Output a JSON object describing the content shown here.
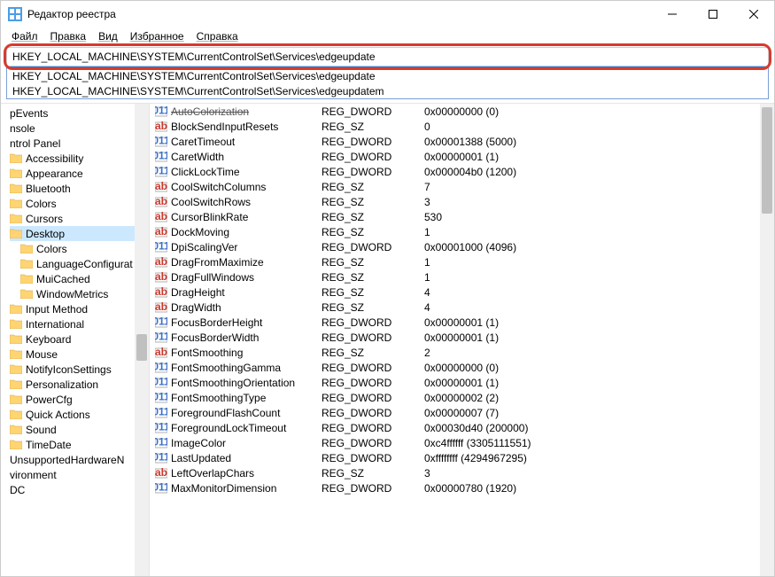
{
  "window": {
    "title": "Редактор реестра"
  },
  "menu": {
    "file": "Файл",
    "edit": "Правка",
    "view": "Вид",
    "favorites": "Избранное",
    "help": "Справка"
  },
  "address": {
    "value": "HKEY_LOCAL_MACHINE\\SYSTEM\\CurrentControlSet\\Services\\edgeupdate"
  },
  "suggestions": [
    "HKEY_LOCAL_MACHINE\\SYSTEM\\CurrentControlSet\\Services\\edgeupdate",
    "HKEY_LOCAL_MACHINE\\SYSTEM\\CurrentControlSet\\Services\\edgeupdatem"
  ],
  "tree": [
    {
      "label": "pEvents",
      "indent": 0
    },
    {
      "label": "nsole",
      "indent": 0
    },
    {
      "label": "ntrol Panel",
      "indent": 0
    },
    {
      "label": "Accessibility",
      "indent": 0,
      "folder": true
    },
    {
      "label": "Appearance",
      "indent": 0,
      "folder": true
    },
    {
      "label": "Bluetooth",
      "indent": 0,
      "folder": true
    },
    {
      "label": "Colors",
      "indent": 0,
      "folder": true
    },
    {
      "label": "Cursors",
      "indent": 0,
      "folder": true
    },
    {
      "label": "Desktop",
      "indent": 0,
      "folder": true,
      "selected": true
    },
    {
      "label": "Colors",
      "indent": 1,
      "folder": true
    },
    {
      "label": "LanguageConfigurat",
      "indent": 1,
      "folder": true
    },
    {
      "label": "MuiCached",
      "indent": 1,
      "folder": true
    },
    {
      "label": "WindowMetrics",
      "indent": 1,
      "folder": true
    },
    {
      "label": "Input Method",
      "indent": 0,
      "folder": true
    },
    {
      "label": "International",
      "indent": 0,
      "folder": true
    },
    {
      "label": "Keyboard",
      "indent": 0,
      "folder": true
    },
    {
      "label": "Mouse",
      "indent": 0,
      "folder": true
    },
    {
      "label": "NotifyIconSettings",
      "indent": 0,
      "folder": true
    },
    {
      "label": "Personalization",
      "indent": 0,
      "folder": true
    },
    {
      "label": "PowerCfg",
      "indent": 0,
      "folder": true
    },
    {
      "label": "Quick Actions",
      "indent": 0,
      "folder": true
    },
    {
      "label": "Sound",
      "indent": 0,
      "folder": true
    },
    {
      "label": "TimeDate",
      "indent": 0,
      "folder": true
    },
    {
      "label": "UnsupportedHardwareN",
      "indent": 0
    },
    {
      "label": "vironment",
      "indent": 0
    },
    {
      "label": "DC",
      "indent": 0
    }
  ],
  "values": [
    {
      "icon": "dw",
      "name": "AutoColorization",
      "type": "REG_DWORD",
      "data": "0x00000000 (0)",
      "cut": true
    },
    {
      "icon": "sz",
      "name": "BlockSendInputResets",
      "type": "REG_SZ",
      "data": "0"
    },
    {
      "icon": "dw",
      "name": "CaretTimeout",
      "type": "REG_DWORD",
      "data": "0x00001388 (5000)"
    },
    {
      "icon": "dw",
      "name": "CaretWidth",
      "type": "REG_DWORD",
      "data": "0x00000001 (1)"
    },
    {
      "icon": "dw",
      "name": "ClickLockTime",
      "type": "REG_DWORD",
      "data": "0x000004b0 (1200)"
    },
    {
      "icon": "sz",
      "name": "CoolSwitchColumns",
      "type": "REG_SZ",
      "data": "7"
    },
    {
      "icon": "sz",
      "name": "CoolSwitchRows",
      "type": "REG_SZ",
      "data": "3"
    },
    {
      "icon": "sz",
      "name": "CursorBlinkRate",
      "type": "REG_SZ",
      "data": "530"
    },
    {
      "icon": "sz",
      "name": "DockMoving",
      "type": "REG_SZ",
      "data": "1"
    },
    {
      "icon": "dw",
      "name": "DpiScalingVer",
      "type": "REG_DWORD",
      "data": "0x00001000 (4096)"
    },
    {
      "icon": "sz",
      "name": "DragFromMaximize",
      "type": "REG_SZ",
      "data": "1"
    },
    {
      "icon": "sz",
      "name": "DragFullWindows",
      "type": "REG_SZ",
      "data": "1"
    },
    {
      "icon": "sz",
      "name": "DragHeight",
      "type": "REG_SZ",
      "data": "4"
    },
    {
      "icon": "sz",
      "name": "DragWidth",
      "type": "REG_SZ",
      "data": "4"
    },
    {
      "icon": "dw",
      "name": "FocusBorderHeight",
      "type": "REG_DWORD",
      "data": "0x00000001 (1)"
    },
    {
      "icon": "dw",
      "name": "FocusBorderWidth",
      "type": "REG_DWORD",
      "data": "0x00000001 (1)"
    },
    {
      "icon": "sz",
      "name": "FontSmoothing",
      "type": "REG_SZ",
      "data": "2"
    },
    {
      "icon": "dw",
      "name": "FontSmoothingGamma",
      "type": "REG_DWORD",
      "data": "0x00000000 (0)"
    },
    {
      "icon": "dw",
      "name": "FontSmoothingOrientation",
      "type": "REG_DWORD",
      "data": "0x00000001 (1)"
    },
    {
      "icon": "dw",
      "name": "FontSmoothingType",
      "type": "REG_DWORD",
      "data": "0x00000002 (2)"
    },
    {
      "icon": "dw",
      "name": "ForegroundFlashCount",
      "type": "REG_DWORD",
      "data": "0x00000007 (7)"
    },
    {
      "icon": "dw",
      "name": "ForegroundLockTimeout",
      "type": "REG_DWORD",
      "data": "0x00030d40 (200000)"
    },
    {
      "icon": "dw",
      "name": "ImageColor",
      "type": "REG_DWORD",
      "data": "0xc4ffffff (3305111551)"
    },
    {
      "icon": "dw",
      "name": "LastUpdated",
      "type": "REG_DWORD",
      "data": "0xffffffff (4294967295)"
    },
    {
      "icon": "sz",
      "name": "LeftOverlapChars",
      "type": "REG_SZ",
      "data": "3"
    },
    {
      "icon": "dw",
      "name": "MaxMonitorDimension",
      "type": "REG_DWORD",
      "data": "0x00000780 (1920)"
    }
  ]
}
